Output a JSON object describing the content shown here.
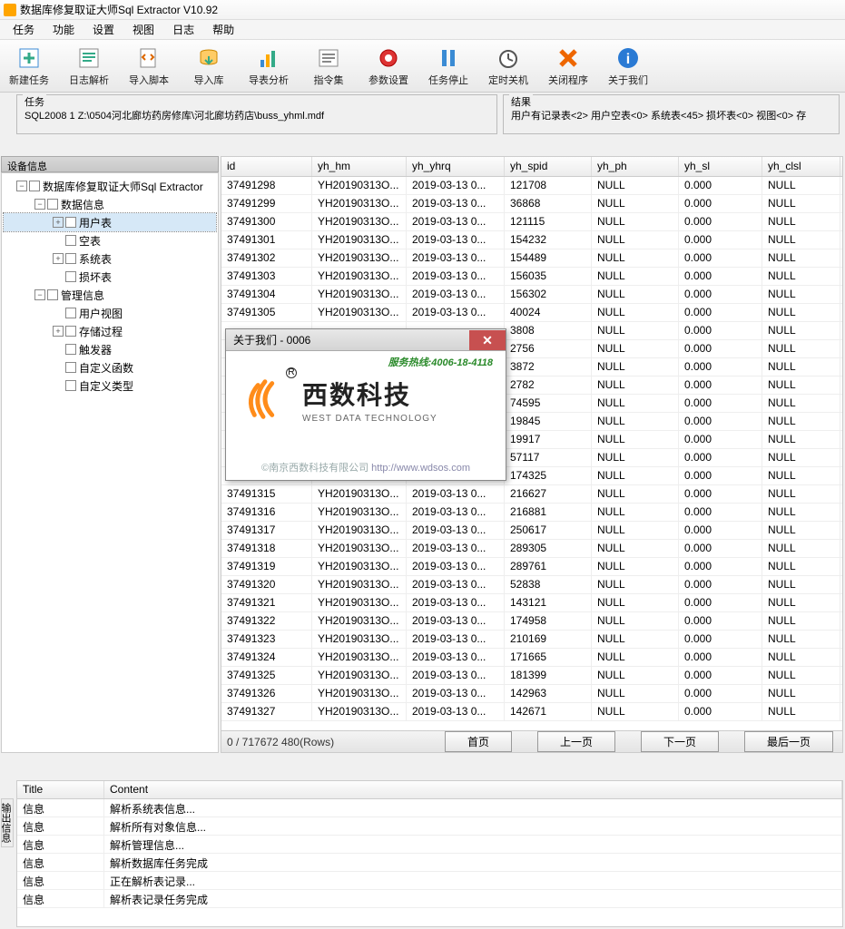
{
  "title": "数据库修复取证大师Sql Extractor V10.92",
  "menu": [
    "任务",
    "功能",
    "设置",
    "视图",
    "日志",
    "帮助"
  ],
  "toolbar": [
    {
      "name": "new-task",
      "label": "新建任务"
    },
    {
      "name": "log-parse",
      "label": "日志解析"
    },
    {
      "name": "import-script",
      "label": "导入脚本"
    },
    {
      "name": "export-lib",
      "label": "导入库"
    },
    {
      "name": "export-analysis",
      "label": "导表分析"
    },
    {
      "name": "cmd-set",
      "label": "指令集"
    },
    {
      "name": "param-set",
      "label": "参数设置"
    },
    {
      "name": "task-stop",
      "label": "任务停止"
    },
    {
      "name": "timed-shutdown",
      "label": "定时关机"
    },
    {
      "name": "close-prog",
      "label": "关闭程序"
    },
    {
      "name": "about",
      "label": "关于我们"
    }
  ],
  "panel_task": {
    "label": "任务",
    "text": "SQL2008 1 Z:\\0504河北廊坊药房修库\\河北廊坊药店\\buss_yhml.mdf"
  },
  "panel_result": {
    "label": "结果",
    "text": "用户有记录表<2> 用户空表<0> 系统表<45> 损坏表<0> 视图<0> 存"
  },
  "device_info_label": "设备信息",
  "tree": {
    "root": "数据库修复取证大师Sql Extractor",
    "data_info": "数据信息",
    "user_table": "用户表",
    "empty_table": "空表",
    "sys_table": "系统表",
    "bad_table": "损坏表",
    "mgmt_info": "管理信息",
    "user_view": "用户视图",
    "stored_proc": "存储过程",
    "trigger": "触发器",
    "custom_func": "自定义函数",
    "custom_type": "自定义类型"
  },
  "grid": {
    "headers": [
      "id",
      "yh_hm",
      "yh_yhrq",
      "yh_spid",
      "yh_ph",
      "yh_sl",
      "yh_clsl"
    ],
    "rows": [
      [
        "37491298",
        "YH20190313O...",
        "2019-03-13 0...",
        "121708",
        "NULL",
        "0.000",
        "NULL"
      ],
      [
        "37491299",
        "YH20190313O...",
        "2019-03-13 0...",
        "36868",
        "NULL",
        "0.000",
        "NULL"
      ],
      [
        "37491300",
        "YH20190313O...",
        "2019-03-13 0...",
        "121115",
        "NULL",
        "0.000",
        "NULL"
      ],
      [
        "37491301",
        "YH20190313O...",
        "2019-03-13 0...",
        "154232",
        "NULL",
        "0.000",
        "NULL"
      ],
      [
        "37491302",
        "YH20190313O...",
        "2019-03-13 0...",
        "154489",
        "NULL",
        "0.000",
        "NULL"
      ],
      [
        "37491303",
        "YH20190313O...",
        "2019-03-13 0...",
        "156035",
        "NULL",
        "0.000",
        "NULL"
      ],
      [
        "37491304",
        "YH20190313O...",
        "2019-03-13 0...",
        "156302",
        "NULL",
        "0.000",
        "NULL"
      ],
      [
        "37491305",
        "YH20190313O...",
        "2019-03-13 0...",
        "40024",
        "NULL",
        "0.000",
        "NULL"
      ],
      [
        "",
        "",
        "",
        "3808",
        "NULL",
        "0.000",
        "NULL"
      ],
      [
        "",
        "",
        "",
        "2756",
        "NULL",
        "0.000",
        "NULL"
      ],
      [
        "",
        "",
        "",
        "3872",
        "NULL",
        "0.000",
        "NULL"
      ],
      [
        "",
        "",
        "",
        "2782",
        "NULL",
        "0.000",
        "NULL"
      ],
      [
        "",
        "",
        "",
        "74595",
        "NULL",
        "0.000",
        "NULL"
      ],
      [
        "",
        "",
        "",
        "19845",
        "NULL",
        "0.000",
        "NULL"
      ],
      [
        "",
        "",
        "",
        "19917",
        "NULL",
        "0.000",
        "NULL"
      ],
      [
        "",
        "",
        "",
        "57117",
        "NULL",
        "0.000",
        "NULL"
      ],
      [
        "37491314",
        "YH20190313O...",
        "2019-03-13 0...",
        "174325",
        "NULL",
        "0.000",
        "NULL"
      ],
      [
        "37491315",
        "YH20190313O...",
        "2019-03-13 0...",
        "216627",
        "NULL",
        "0.000",
        "NULL"
      ],
      [
        "37491316",
        "YH20190313O...",
        "2019-03-13 0...",
        "216881",
        "NULL",
        "0.000",
        "NULL"
      ],
      [
        "37491317",
        "YH20190313O...",
        "2019-03-13 0...",
        "250617",
        "NULL",
        "0.000",
        "NULL"
      ],
      [
        "37491318",
        "YH20190313O...",
        "2019-03-13 0...",
        "289305",
        "NULL",
        "0.000",
        "NULL"
      ],
      [
        "37491319",
        "YH20190313O...",
        "2019-03-13 0...",
        "289761",
        "NULL",
        "0.000",
        "NULL"
      ],
      [
        "37491320",
        "YH20190313O...",
        "2019-03-13 0...",
        "52838",
        "NULL",
        "0.000",
        "NULL"
      ],
      [
        "37491321",
        "YH20190313O...",
        "2019-03-13 0...",
        "143121",
        "NULL",
        "0.000",
        "NULL"
      ],
      [
        "37491322",
        "YH20190313O...",
        "2019-03-13 0...",
        "174958",
        "NULL",
        "0.000",
        "NULL"
      ],
      [
        "37491323",
        "YH20190313O...",
        "2019-03-13 0...",
        "210169",
        "NULL",
        "0.000",
        "NULL"
      ],
      [
        "37491324",
        "YH20190313O...",
        "2019-03-13 0...",
        "171665",
        "NULL",
        "0.000",
        "NULL"
      ],
      [
        "37491325",
        "YH20190313O...",
        "2019-03-13 0...",
        "181399",
        "NULL",
        "0.000",
        "NULL"
      ],
      [
        "37491326",
        "YH20190313O...",
        "2019-03-13 0...",
        "142963",
        "NULL",
        "0.000",
        "NULL"
      ],
      [
        "37491327",
        "YH20190313O...",
        "2019-03-13 0...",
        "142671",
        "NULL",
        "0.000",
        "NULL"
      ]
    ]
  },
  "pager": {
    "info": "0 / 717672  480(Rows)",
    "first": "首页",
    "prev": "上一页",
    "next": "下一页",
    "last": "最后一页"
  },
  "log": {
    "headers": [
      "Title",
      "Content"
    ],
    "rows": [
      [
        "信息",
        "解析系统表信息..."
      ],
      [
        "信息",
        "解析所有对象信息..."
      ],
      [
        "信息",
        "解析管理信息..."
      ],
      [
        "信息",
        "解析数据库任务完成"
      ],
      [
        "信息",
        "正在解析表记录..."
      ],
      [
        "信息",
        "解析表记录任务完成"
      ]
    ]
  },
  "vert_label": "设备信息",
  "vert_label2": "输出信息",
  "dialog": {
    "title": "关于我们 - 0006",
    "hotline": "服务热线:4006-18-4118",
    "brand_cn": "西数科技",
    "brand_en": "WEST DATA TECHNOLOGY",
    "copyright": "©南京西数科技有限公司 ",
    "url": "http://www.wdsos.com"
  }
}
